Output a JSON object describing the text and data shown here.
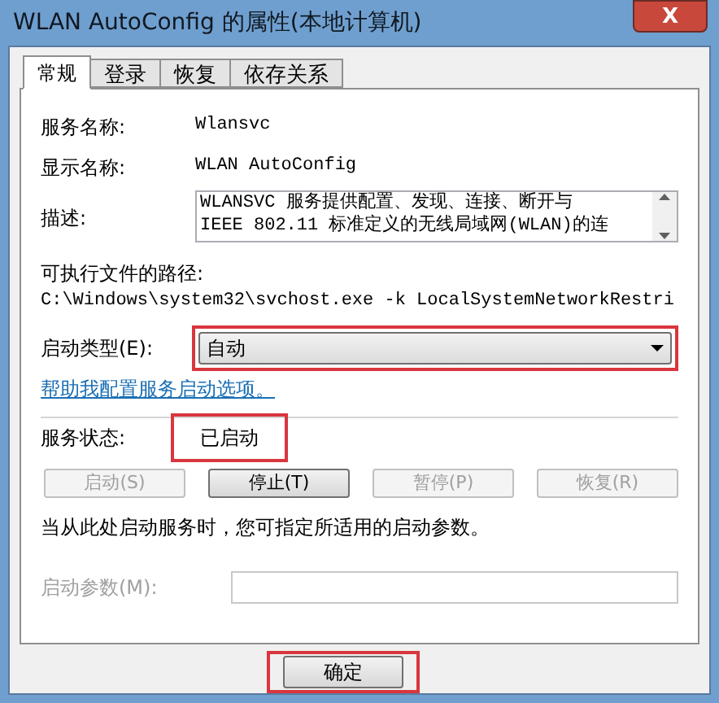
{
  "window": {
    "title": "WLAN AutoConfig 的属性(本地计算机)",
    "close": "X"
  },
  "tabs": [
    {
      "label": "常规",
      "selected": true
    },
    {
      "label": "登录",
      "selected": false
    },
    {
      "label": "恢复",
      "selected": false
    },
    {
      "label": "依存关系",
      "selected": false
    }
  ],
  "fields": [
    {
      "label": "服务名称:",
      "value": "Wlansvc"
    },
    {
      "label": "显示名称:",
      "value": "WLAN AutoConfig"
    }
  ],
  "description": {
    "label": "描述:",
    "lines": [
      "WLANSVC 服务提供配置、发现、连接、断开与",
      "IEEE 802.11 标准定义的无线局域网(WLAN)的连"
    ]
  },
  "path": {
    "label": "可执行文件的路径:",
    "value": "C:\\Windows\\system32\\svchost.exe -k LocalSystemNetworkRestri"
  },
  "startup_type": {
    "label": "启动类型(E):",
    "value": "自动",
    "highlighted": true
  },
  "help_link": "帮助我配置服务启动选项。",
  "service_status": {
    "label": "服务状态:",
    "value": "已启动",
    "highlighted": true
  },
  "service_buttons": [
    {
      "label": "启动(S)",
      "disabled": true
    },
    {
      "label": "停止(T)",
      "disabled": false
    },
    {
      "label": "暂停(P)",
      "disabled": true
    },
    {
      "label": "恢复(R)",
      "disabled": true
    }
  ],
  "hint": "当从此处启动服务时，您可指定所适用的启动参数。",
  "start_params": {
    "label": "启动参数(M):",
    "disabled": true
  },
  "ok_button": {
    "label": "确定",
    "highlighted": true
  }
}
